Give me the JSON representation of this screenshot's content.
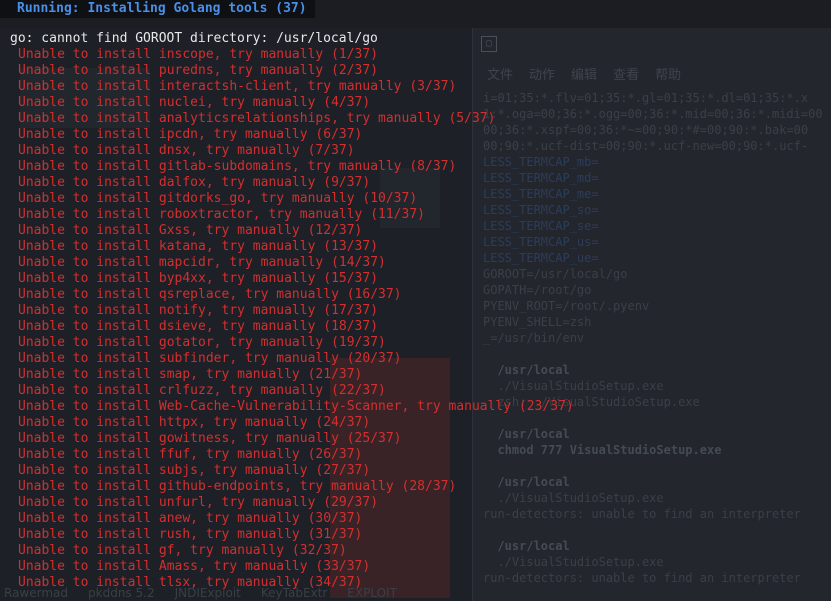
{
  "header": {
    "running": "Running: Installing Golang tools (37)"
  },
  "error": {
    "goroot": "go: cannot find GOROOT directory: /usr/local/go"
  },
  "install_lines": [
    "Unable to install inscope, try manually (1/37)",
    "Unable to install puredns, try manually (2/37)",
    "Unable to install interactsh-client, try manually (3/37)",
    "Unable to install nuclei, try manually (4/37)",
    "Unable to install analyticsrelationships, try manually (5/37)",
    "Unable to install ipcdn, try manually (6/37)",
    "Unable to install dnsx, try manually (7/37)",
    "Unable to install gitlab-subdomains, try manually (8/37)",
    "Unable to install dalfox, try manually (9/37)",
    "Unable to install gitdorks_go, try manually (10/37)",
    "Unable to install roboxtractor, try manually (11/37)",
    "Unable to install Gxss, try manually (12/37)",
    "Unable to install katana, try manually (13/37)",
    "Unable to install mapcidr, try manually (14/37)",
    "Unable to install byp4xx, try manually (15/37)",
    "Unable to install qsreplace, try manually (16/37)",
    "Unable to install notify, try manually (17/37)",
    "Unable to install dsieve, try manually (18/37)",
    "Unable to install gotator, try manually (19/37)",
    "Unable to install subfinder, try manually (20/37)",
    "Unable to install smap, try manually (21/37)",
    "Unable to install crlfuzz, try manually (22/37)",
    "Unable to install Web-Cache-Vulnerability-Scanner, try manually (23/37)",
    "Unable to install httpx, try manually (24/37)",
    "Unable to install gowitness, try manually (25/37)",
    "Unable to install ffuf, try manually (26/37)",
    "Unable to install subjs, try manually (27/37)",
    "Unable to install github-endpoints, try manually (28/37)",
    "Unable to install unfurl, try manually (29/37)",
    "Unable to install anew, try manually (30/37)",
    "Unable to install rush, try manually (31/37)",
    "Unable to install gf, try manually (32/37)",
    "Unable to install Amass, try manually (33/37)",
    "Unable to install tlsx, try manually (34/37)"
  ],
  "background_window": {
    "menu": [
      "文件",
      "动作",
      "编辑",
      "查看",
      "帮助"
    ],
    "lines": [
      "i=01;35:*.flv=01;35:*.gl=01;35:*.dl=01;35:*.x",
      "1:*.oga=00;36:*.ogg=00;36:*.mid=00;36:*.midi=00",
      "00;36:*.xspf=00;36:*~=00;90:*#=00;90:*.bak=00",
      "00;90:*.ucf-dist=00;90:*.ucf-new=00;90:*.ucf-",
      "LESS_TERMCAP_mb=",
      "LESS_TERMCAP_md=",
      "LESS_TERMCAP_me=",
      "LESS_TERMCAP_so=",
      "LESS_TERMCAP_se=",
      "LESS_TERMCAP_us=",
      "LESS_TERMCAP_ue=",
      "GOROOT=/usr/local/go",
      "GOPATH=/root/go",
      "PYENV_ROOT=/root/.pyenv",
      "PYENV_SHELL=zsh",
      "_=/usr/bin/env",
      "",
      "  /usr/local",
      "  ./VisualStudioSetup.exe",
      "  zsh: ./VisualStudioSetup.exe",
      "",
      "  /usr/local",
      "  chmod 777 VisualStudioSetup.exe",
      "",
      "  /usr/local",
      "  ./VisualStudioSetup.exe",
      "run-detectors: unable to find an interpreter",
      "",
      "  /usr/local",
      "  ./VisualStudioSetup.exe",
      "run-detectors: unable to find an interpreter"
    ]
  },
  "taskbar": [
    "Rawermad",
    "pkddns 5.2",
    "JNDIExploit",
    "KeyTabExtr",
    "EXPLOIT"
  ],
  "colors": {
    "error_red": "#d42f2f",
    "running_blue": "#4a8fe8",
    "text": "#e8e8e8"
  }
}
